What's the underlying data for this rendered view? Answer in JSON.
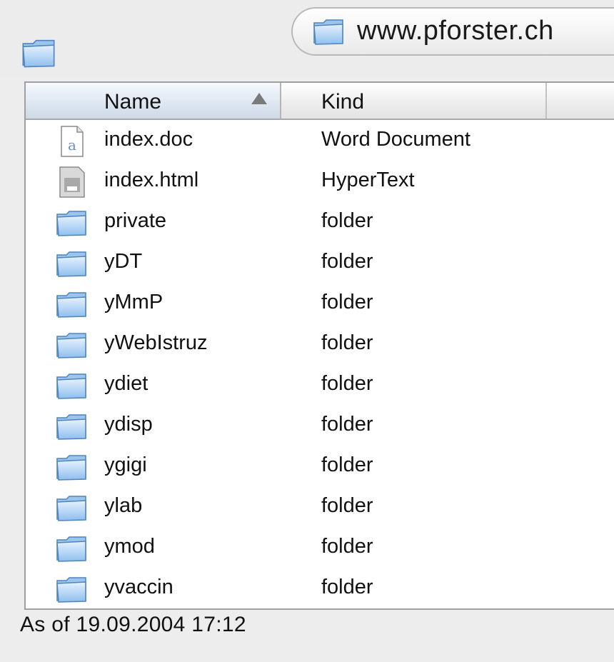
{
  "window": {
    "path_label": "www.pforster.ch"
  },
  "columns": {
    "name": "Name",
    "kind": "Kind"
  },
  "files": [
    {
      "name": "index.doc",
      "kind": "Word Document",
      "icon": "word-document-icon"
    },
    {
      "name": "index.html",
      "kind": "HyperText",
      "icon": "html-document-icon"
    },
    {
      "name": "private",
      "kind": "folder",
      "icon": "folder-icon"
    },
    {
      "name": "yDT",
      "kind": "folder",
      "icon": "folder-icon"
    },
    {
      "name": "yMmP",
      "kind": "folder",
      "icon": "folder-icon"
    },
    {
      "name": "yWebIstruz",
      "kind": "folder",
      "icon": "folder-icon"
    },
    {
      "name": "ydiet",
      "kind": "folder",
      "icon": "folder-icon"
    },
    {
      "name": "ydisp",
      "kind": "folder",
      "icon": "folder-icon"
    },
    {
      "name": "ygigi",
      "kind": "folder",
      "icon": "folder-icon"
    },
    {
      "name": "ylab",
      "kind": "folder",
      "icon": "folder-icon"
    },
    {
      "name": "ymod",
      "kind": "folder",
      "icon": "folder-icon"
    },
    {
      "name": "yvaccin",
      "kind": "folder",
      "icon": "folder-icon"
    }
  ],
  "status": {
    "text": "As of 19.09.2004 17:12"
  },
  "colors": {
    "folder_light": "#cfe6fb",
    "folder_dark": "#5d9ad6",
    "header_selected": "#dfe8f2"
  }
}
